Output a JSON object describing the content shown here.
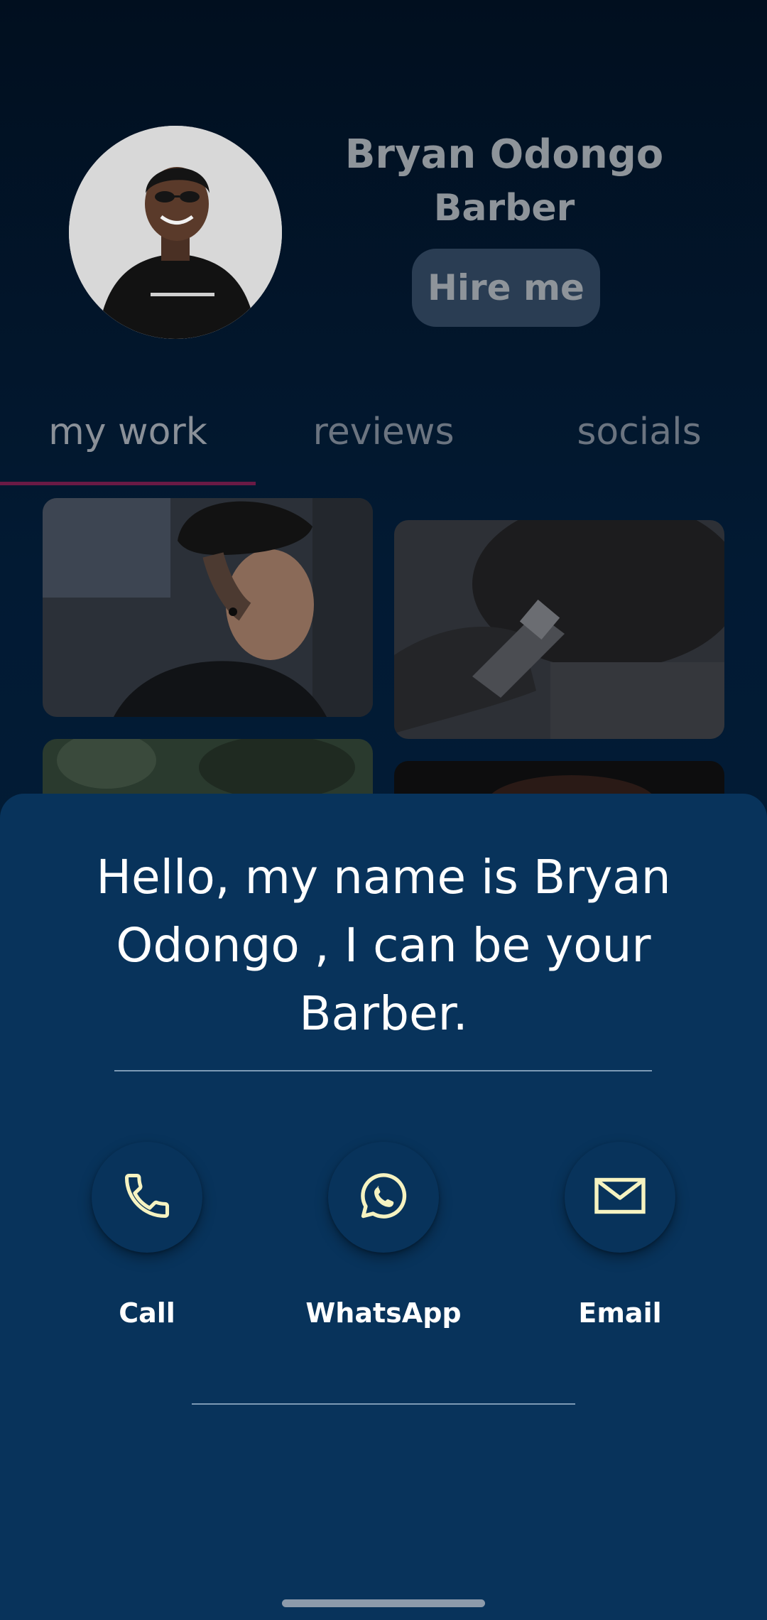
{
  "profile": {
    "name": "Bryan Odongo",
    "role": "Barber",
    "hire_label": "Hire me"
  },
  "tabs": [
    {
      "label": "my work",
      "active": true
    },
    {
      "label": "reviews",
      "active": false
    },
    {
      "label": "socials",
      "active": false
    }
  ],
  "sheet": {
    "intro": "Hello, my name is Bryan Odongo , I can be your Barber.",
    "contacts": [
      {
        "label": "Call",
        "icon": "phone-icon"
      },
      {
        "label": "WhatsApp",
        "icon": "whatsapp-icon"
      },
      {
        "label": "Email",
        "icon": "email-icon"
      }
    ]
  },
  "colors": {
    "tab_indicator": "#6a1a45",
    "sheet_background": "#08335b",
    "icon_accent": "#f6f3c1"
  }
}
